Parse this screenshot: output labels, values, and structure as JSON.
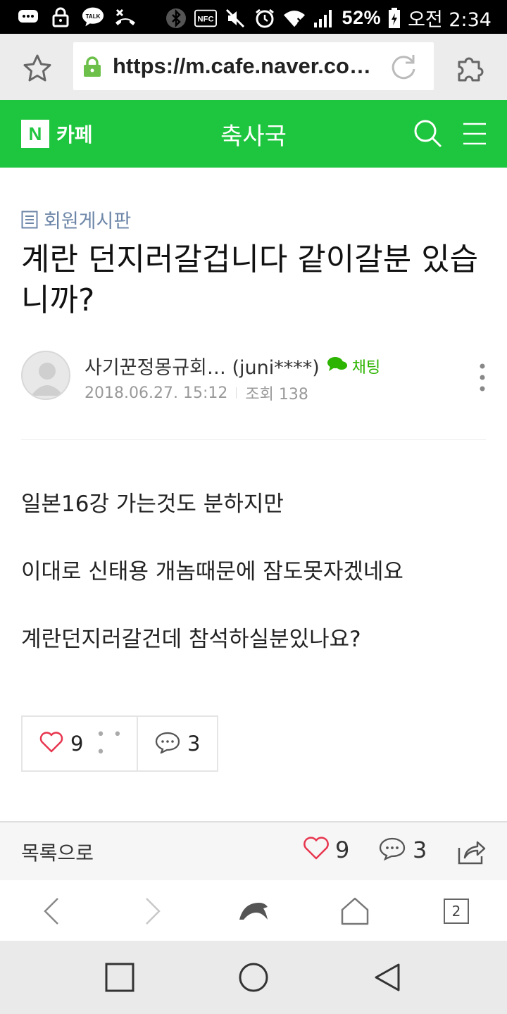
{
  "status_bar": {
    "talk_label": "TALK",
    "nfc_label": "NFC",
    "battery": "52%",
    "time": "오전 2:34",
    "icons": [
      "message-icon",
      "lock-icon",
      "talk-icon",
      "missed-call-icon",
      "bluetooth-icon",
      "nfc-icon",
      "mute-icon",
      "alarm-icon",
      "wifi-icon",
      "signal-icon",
      "battery-icon"
    ]
  },
  "browser": {
    "url": "https://m.cafe.naver.co…"
  },
  "cafe_header": {
    "logo_letter": "N",
    "service_label": "카페",
    "cafe_name": "축사국"
  },
  "post": {
    "board": "회원게시판",
    "title": "계란 던지러갈겁니다 같이갈분 있습니까?",
    "author": "사기꾼정몽규회… (juni****)",
    "chat_label": "채팅",
    "date": "2018.06.27. 15:12",
    "views": "조회 138",
    "body": [
      "일본16강 가는것도 분하지만",
      "이대로 신태용 개놈때문에 잠도못자겠네요",
      "계란던지러갈건데 참석하실분있나요?"
    ],
    "likes": "9",
    "comments": "3"
  },
  "action_bar": {
    "list_label": "목록으로",
    "likes": "9",
    "comments": "3"
  },
  "browser_nav": {
    "tab_count": "2"
  },
  "colors": {
    "cafe_green": "#1ec53e",
    "board_link": "#6d86a8",
    "chat_green": "#2db400",
    "heart_red": "#e8364f"
  }
}
